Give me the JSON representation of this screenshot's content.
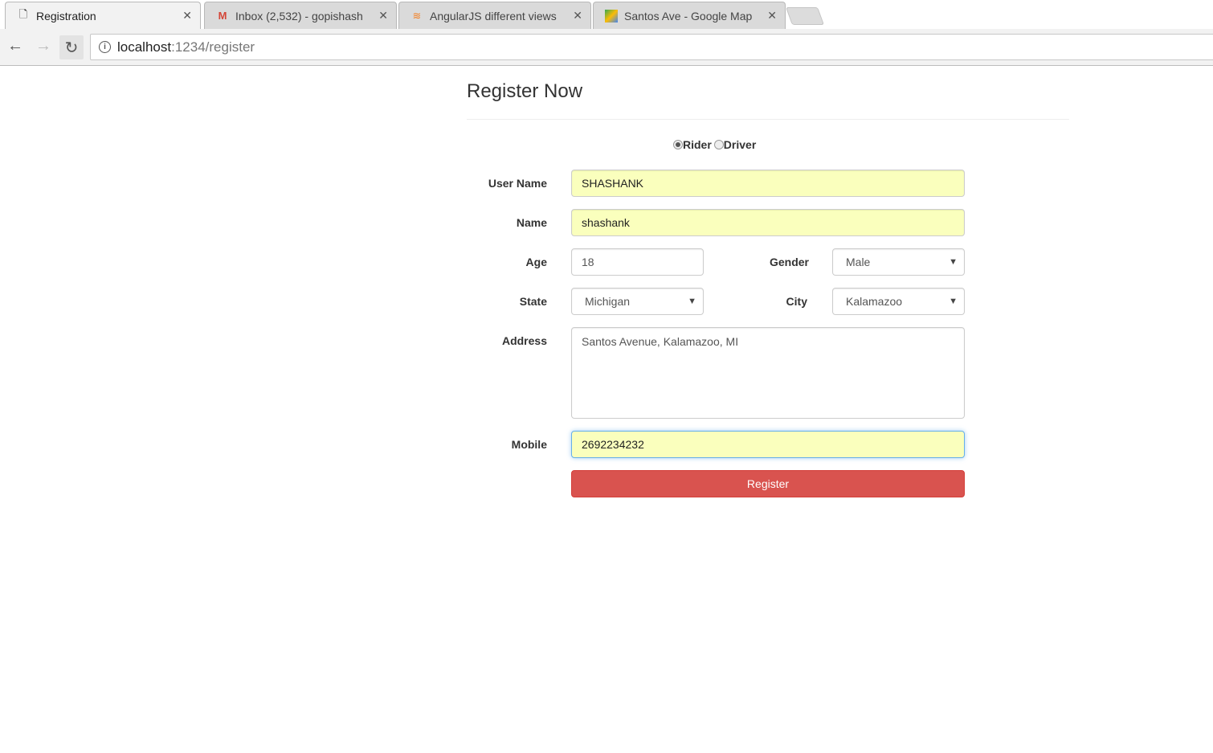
{
  "tabs": [
    {
      "title": "Registration",
      "icon": "page-icon"
    },
    {
      "title": "Inbox (2,532) - gopishash",
      "icon": "gmail-icon"
    },
    {
      "title": "AngularJS different views",
      "icon": "stackoverflow-icon"
    },
    {
      "title": "Santos Ave - Google Map",
      "icon": "maps-icon"
    }
  ],
  "url": {
    "host": "localhost",
    "path": ":1234/register"
  },
  "form": {
    "title": "Register Now",
    "role_options": [
      "Rider",
      "Driver"
    ],
    "role_selected": "Rider",
    "labels": {
      "username": "User Name",
      "name": "Name",
      "age": "Age",
      "gender": "Gender",
      "state": "State",
      "city": "City",
      "address": "Address",
      "mobile": "Mobile"
    },
    "values": {
      "username": "SHASHANK",
      "name": "shashank",
      "age": "18",
      "gender": "Male",
      "state": "Michigan",
      "city": "Kalamazoo",
      "address": "Santos Avenue, Kalamazoo, MI",
      "mobile": "2692234232"
    },
    "submit": "Register"
  },
  "colors": {
    "autofill": "#faffbd",
    "button": "#d9534f"
  }
}
